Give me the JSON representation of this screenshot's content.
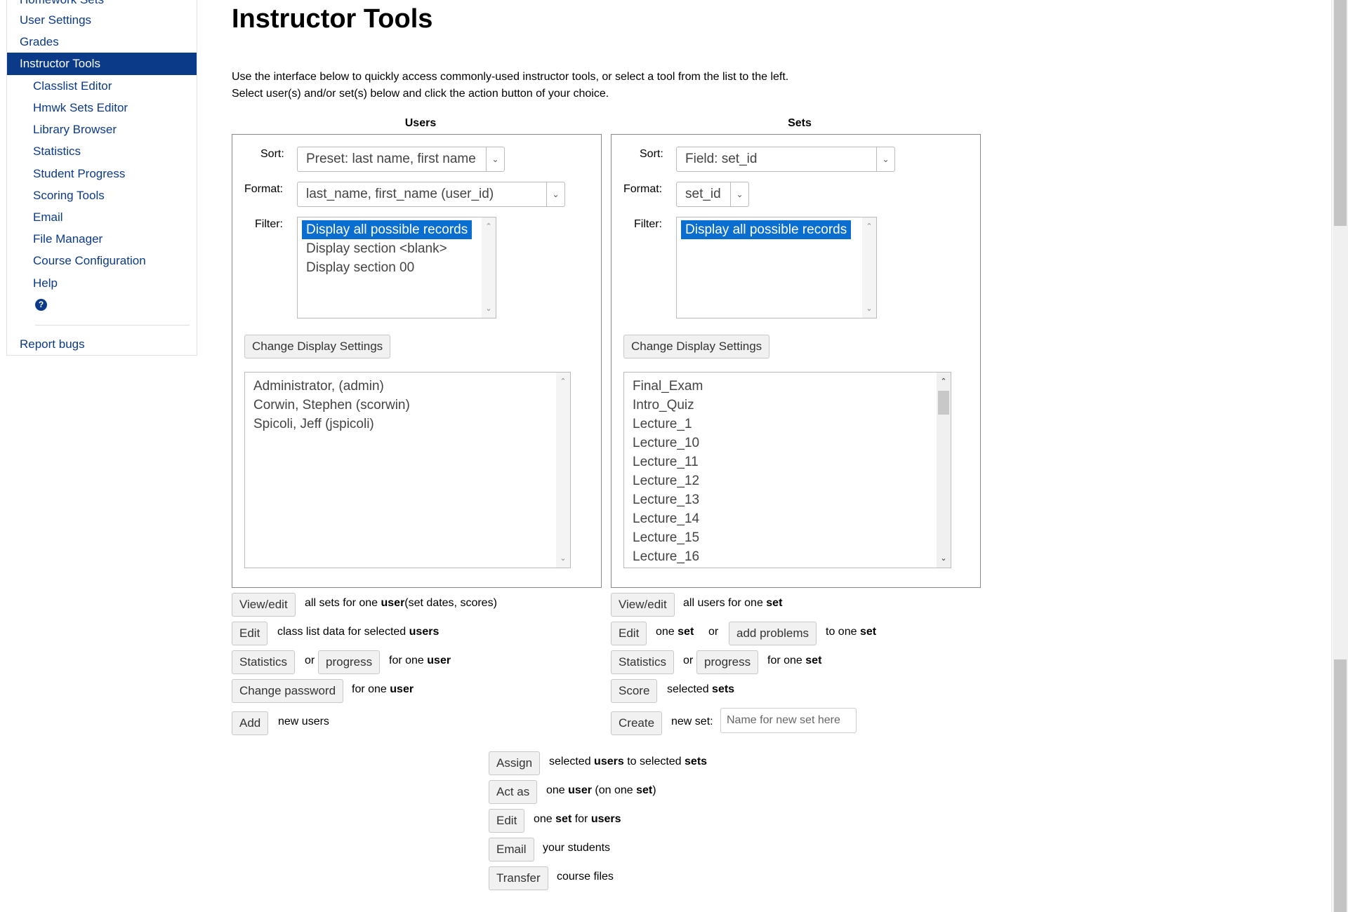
{
  "sidebar": {
    "items": [
      {
        "label": "Homework Sets"
      },
      {
        "label": "User Settings"
      },
      {
        "label": "Grades"
      },
      {
        "label": "Instructor Tools"
      },
      {
        "label": "Classlist Editor"
      },
      {
        "label": "Hmwk Sets Editor"
      },
      {
        "label": "Library Browser"
      },
      {
        "label": "Statistics"
      },
      {
        "label": "Student Progress"
      },
      {
        "label": "Scoring Tools"
      },
      {
        "label": "Email"
      },
      {
        "label": "File Manager"
      },
      {
        "label": "Course Configuration"
      },
      {
        "label": "Help"
      }
    ],
    "help_icon": "?",
    "report_bugs": "Report bugs"
  },
  "page": {
    "title": "Instructor Tools",
    "intro_line1": "Use the interface below to quickly access commonly-used instructor tools, or select a tool from the list to the left.",
    "intro_line2": "Select user(s) and/or set(s) below and click the action button of your choice."
  },
  "users": {
    "title": "Users",
    "sort_label": "Sort:",
    "sort_value": "Preset: last name, first name",
    "format_label": "Format:",
    "format_value": "last_name, first_name (user_id)",
    "filter_label": "Filter:",
    "filters": [
      "Display all possible records",
      "Display section <blank>",
      "Display section 00"
    ],
    "change_display": "Change Display Settings",
    "list": [
      "Administrator, (admin)",
      "Corwin, Stephen (scorwin)",
      "Spicoli, Jeff (jspicoli)"
    ]
  },
  "sets": {
    "title": "Sets",
    "sort_label": "Sort:",
    "sort_value": "Field: set_id",
    "format_label": "Format:",
    "format_value": "set_id",
    "filter_label": "Filter:",
    "filters": [
      "Display all possible records"
    ],
    "change_display": "Change Display Settings",
    "list": [
      "Final_Exam",
      "Intro_Quiz",
      "Lecture_1",
      "Lecture_10",
      "Lecture_11",
      "Lecture_12",
      "Lecture_13",
      "Lecture_14",
      "Lecture_15",
      "Lecture_16"
    ]
  },
  "user_actions": {
    "view_edit": "View/edit",
    "view_edit_t1": "all sets for one ",
    "view_edit_b1": "user",
    "view_edit_t2": "(set dates, scores)",
    "edit": "Edit",
    "edit_t1": "class list data for selected ",
    "edit_b1": "users",
    "statistics": "Statistics",
    "or": "or",
    "progress": "progress",
    "stats_t1": "for one ",
    "stats_b1": "user",
    "change_password": "Change password",
    "pw_t1": "for one ",
    "pw_b1": "user",
    "add": "Add",
    "add_t1": "new users"
  },
  "set_actions": {
    "view_edit": "View/edit",
    "view_edit_t1": "all users for one ",
    "view_edit_b1": "set",
    "edit": "Edit",
    "edit_t1": "one ",
    "edit_b1": "set",
    "or": "or",
    "add_problems": "add problems",
    "add_t1": "to one ",
    "add_b1": "set",
    "statistics": "Statistics",
    "progress": "progress",
    "stats_t1": "for one ",
    "stats_b1": "set",
    "score": "Score",
    "score_t1": "selected ",
    "score_b1": "sets",
    "create": "Create",
    "create_t1": "new set:",
    "new_set_placeholder": "Name for new set here"
  },
  "combined_actions": {
    "assign": "Assign",
    "assign_t1": "selected ",
    "assign_b1": "users",
    "assign_t2": " to selected ",
    "assign_b2": "sets",
    "act_as": "Act as",
    "act_t1": "one ",
    "act_b1": "user",
    "act_t2": " (on one ",
    "act_b2": "set",
    "act_t3": ")",
    "edit": "Edit",
    "edit_t1": "one ",
    "edit_b1": "set",
    "edit_t2": " for ",
    "edit_b2": "users",
    "email": "Email",
    "email_t1": "your students",
    "transfer": "Transfer",
    "transfer_t1": "course files"
  }
}
